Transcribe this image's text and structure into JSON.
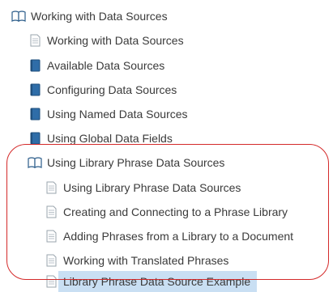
{
  "tree": {
    "root": {
      "label": "Working with Data Sources",
      "icon": "open-book-icon"
    },
    "items": [
      {
        "label": "Working with Data Sources",
        "icon": "page-icon"
      },
      {
        "label": "Available Data Sources",
        "icon": "closed-book-icon"
      },
      {
        "label": "Configuring Data Sources",
        "icon": "closed-book-icon"
      },
      {
        "label": "Using Named Data Sources",
        "icon": "closed-book-icon"
      },
      {
        "label": "Using Global Data Fields",
        "icon": "closed-book-icon"
      },
      {
        "label": "Using Library Phrase Data Sources",
        "icon": "open-book-icon",
        "children": [
          {
            "label": "Using Library Phrase Data Sources",
            "icon": "page-icon"
          },
          {
            "label": "Creating and Connecting to a Phrase Library",
            "icon": "page-icon"
          },
          {
            "label": "Adding Phrases from a Library to a Document",
            "icon": "page-icon"
          },
          {
            "label": "Working with Translated Phrases",
            "icon": "page-icon"
          },
          {
            "label": "Library Phrase Data Source Example",
            "icon": "page-icon",
            "selected": true
          }
        ]
      }
    ]
  },
  "colors": {
    "selected_background": "#c9dff3",
    "annotation_outline": "#d42a2a",
    "closed_book": "#2f6da8"
  }
}
